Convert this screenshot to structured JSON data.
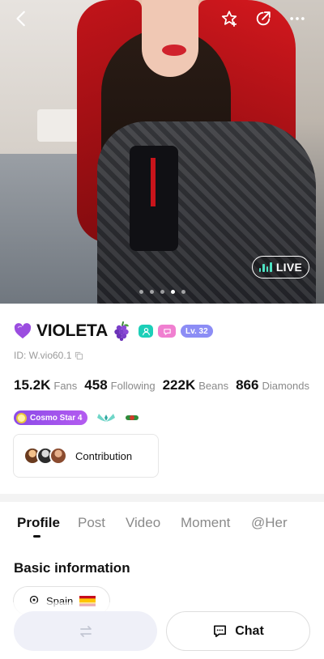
{
  "profile": {
    "name": "VIOLETA",
    "level": "Lv. 32",
    "id_text": "ID: W.vio60.1",
    "live_label": "LIVE",
    "photo_pages": 5,
    "photo_active_index": 3
  },
  "stats": [
    {
      "value": "15.2K",
      "label": "Fans"
    },
    {
      "value": "458",
      "label": "Following"
    },
    {
      "value": "222K",
      "label": "Beans"
    },
    {
      "value": "866",
      "label": "Diamonds"
    }
  ],
  "badges": {
    "cosmo_label": "Cosmo Star 4"
  },
  "contribution": {
    "label": "Contribution"
  },
  "tabs": [
    "Profile",
    "Post",
    "Video",
    "Moment",
    "@Her"
  ],
  "active_tab": "Profile",
  "basic_info": {
    "title": "Basic information",
    "location": "Spain"
  },
  "actions": {
    "chat_label": "Chat"
  },
  "colors": {
    "accent_teal": "#1ccfb8",
    "level_purple": "#8c8df5",
    "cosmo_purple": "#8b4ae8",
    "live_green": "#4ee3c3"
  },
  "icons": [
    "back-icon",
    "star-add-icon",
    "share-icon",
    "more-icon",
    "heart-icon",
    "grape-icon",
    "copy-icon",
    "wings-icon",
    "location-icon",
    "follow-swap-icon",
    "chat-icon"
  ]
}
